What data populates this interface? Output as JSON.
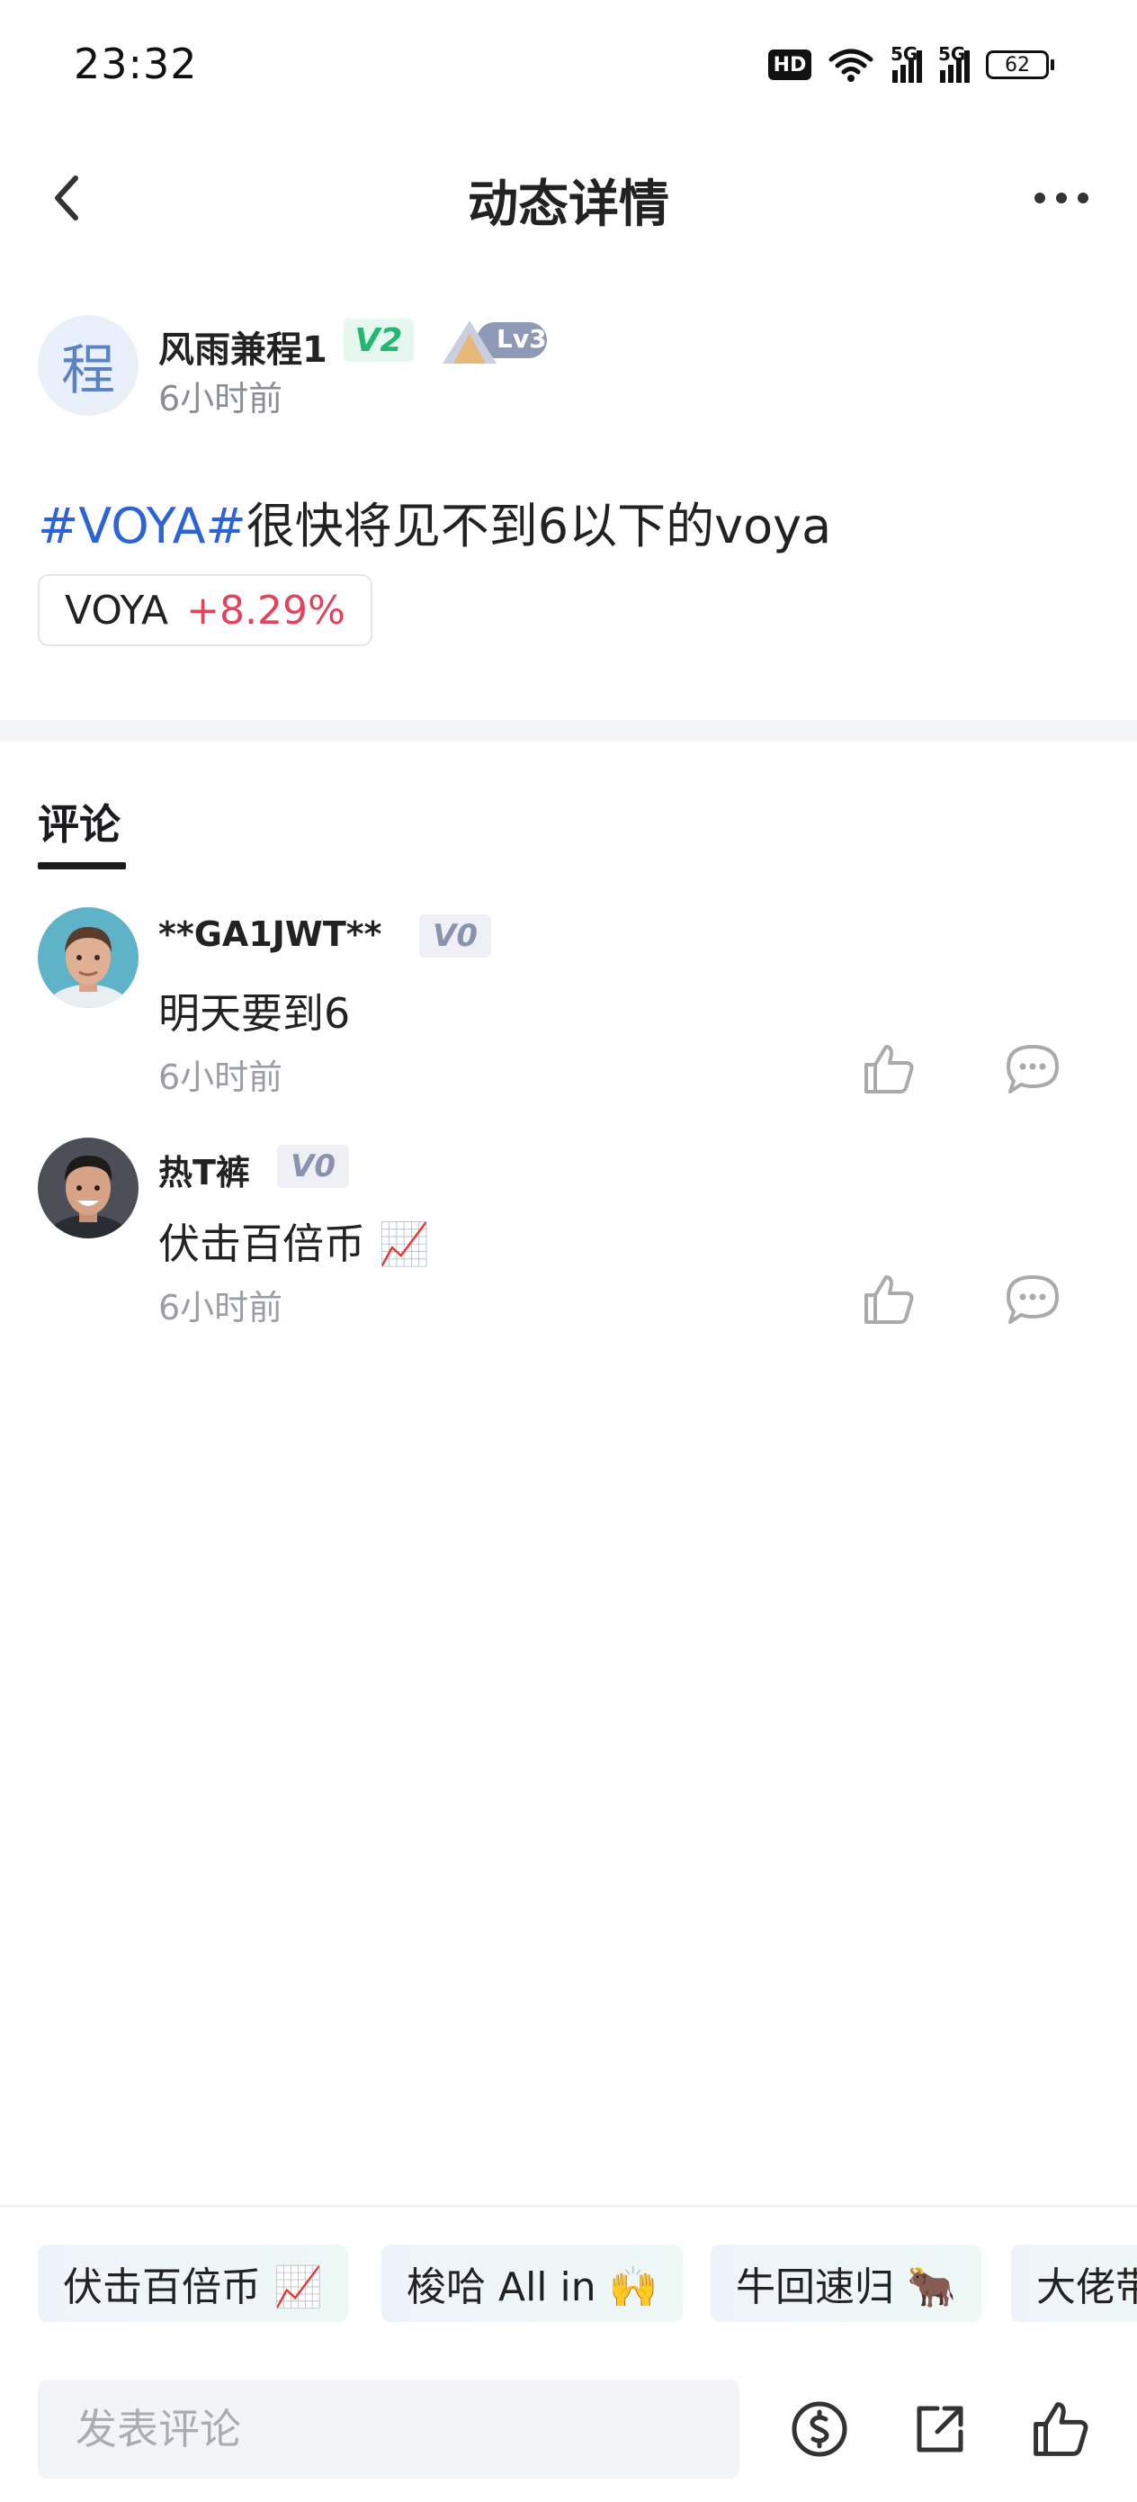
{
  "status_bar": {
    "time": "23:32",
    "hd_label": "HD",
    "network_1": "5G",
    "network_2": "5G",
    "battery": "62"
  },
  "nav": {
    "title": "动态详情",
    "back_icon": "chevron-left-icon",
    "more_icon": "more-horizontal-icon"
  },
  "post": {
    "author": {
      "avatar_char": "程",
      "name": "风雨兼程1",
      "vip_badge": "V2",
      "level_badge": "Lv3"
    },
    "time": "6小时前",
    "tag": "#VOYA#",
    "text": "很快将见不到6以下的voya",
    "stock": {
      "symbol": "VOYA",
      "change": "+8.29%",
      "change_color": "#e0435a"
    }
  },
  "comments_section": {
    "title": "评论",
    "items": [
      {
        "name": "**GA1JWT**",
        "badge": "V0",
        "text": "明天要到6",
        "time": "6小时前"
      },
      {
        "name": "热T裤",
        "badge": "V0",
        "text": "伏击百倍币 📈",
        "time": "6小时前"
      }
    ]
  },
  "quick_replies": [
    "伏击百倍币 📈",
    "梭哈 All in 🙌",
    "牛回速归 🐂",
    "大佬带带我"
  ],
  "bottom_bar": {
    "input_placeholder": "发表评论",
    "icons": [
      "tip-coin-icon",
      "share-icon",
      "like-icon"
    ]
  },
  "colors": {
    "accent_blue": "#2c63d6",
    "up_red": "#e0435a",
    "vip_green": "#22b872"
  }
}
